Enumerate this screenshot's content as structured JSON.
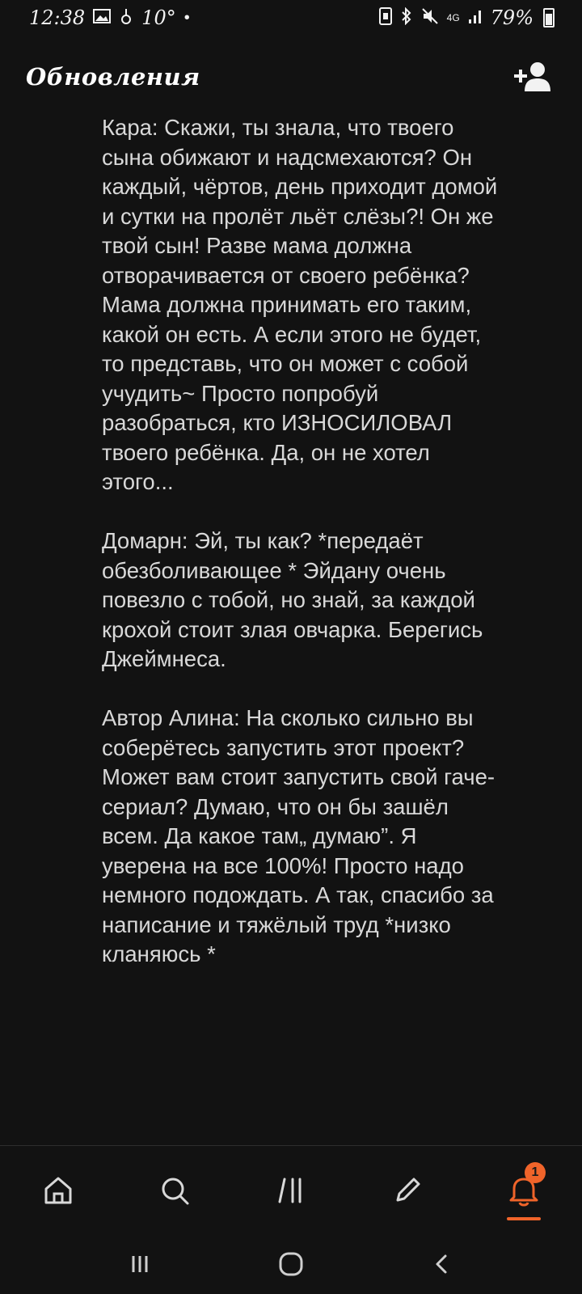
{
  "status_bar": {
    "time": "12:38",
    "temperature": "10°",
    "network": "4G",
    "battery": "79%"
  },
  "app_bar": {
    "title": "Обновления"
  },
  "content": {
    "paragraphs": [
      "Кара: Скажи, ты знала, что твоего сына обижают и надсмехаются? Он каждый, чёртов, день приходит домой и сутки на пролёт льёт слёзы?! Он же твой сын! Разве мама должна отворачивается от своего ребёнка? Мама должна принимать его таким, какой он есть. А если этого не будет, то представь, что он может с собой учудить~ Просто попробуй разобраться, кто ИЗНОСИЛОВАЛ твоего ребёнка. Да, он не хотел этого...",
      "Домарн: Эй, ты как? *передаёт обезболивающее * Эйдану очень повезло с тобой, но знай, за каждой крохой стоит злая овчарка. Берегись Джеймнеса.",
      "Автор Алина: На сколько сильно вы соберётесь запустить этот проект? Может вам стоит запустить свой гаче-сериал? Думаю, что он бы зашёл всем. Да какое там„ думаю”. Я уверена на все 100%! Просто надо немного подождать. А так, спасибо за написание и тяжёлый труд *низко кланяюсь *"
    ]
  },
  "bottom_nav": {
    "items": [
      "home-icon",
      "search-icon",
      "library-icon",
      "write-icon",
      "notifications-icon"
    ],
    "active": "notifications-icon",
    "notification_badge": "1",
    "accent_color": "#f0642a"
  },
  "system_nav": {
    "items": [
      "recent-apps-icon",
      "home-button-icon",
      "back-icon"
    ]
  }
}
